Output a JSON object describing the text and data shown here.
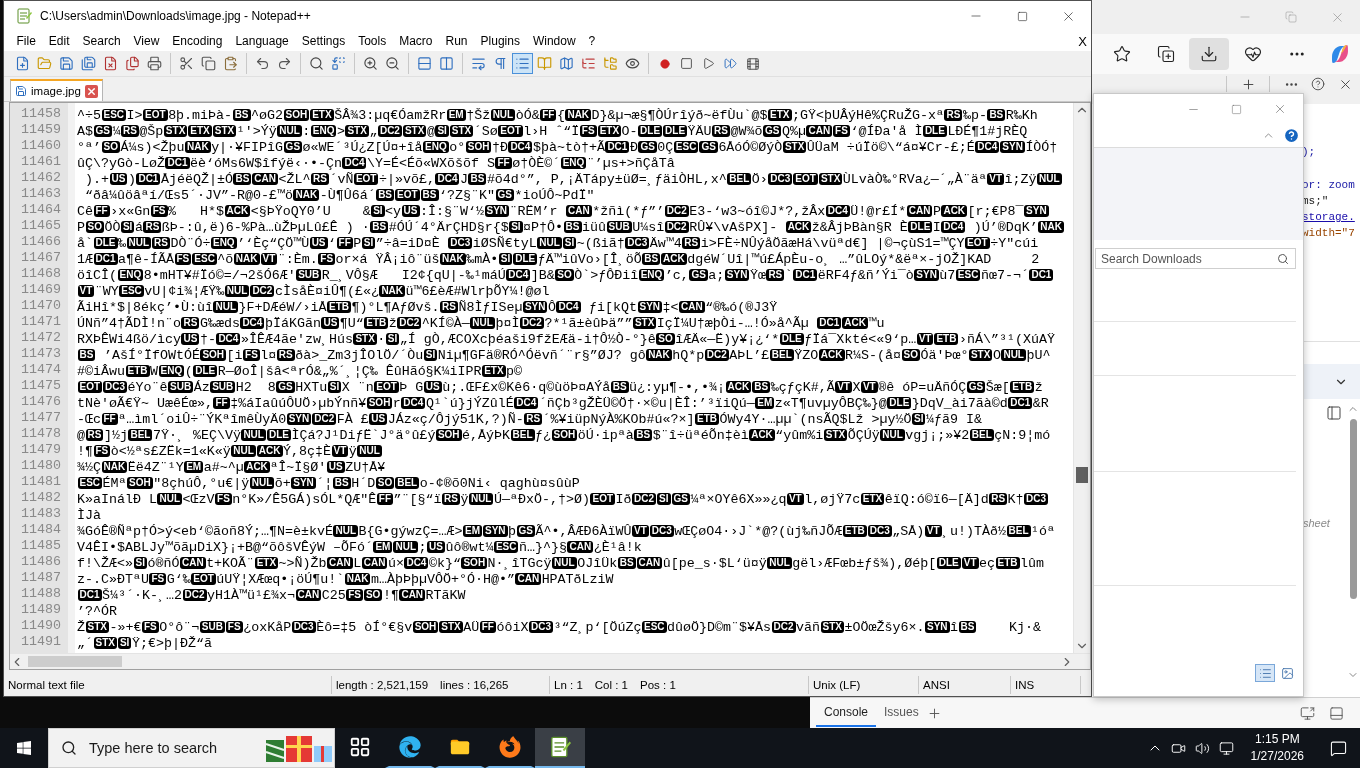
{
  "window": {
    "title": "C:\\Users\\admin\\Downloads\\image.jpg - Notepad++"
  },
  "menu_bar": {
    "items": [
      "File",
      "Edit",
      "Search",
      "View",
      "Encoding",
      "Language",
      "Settings",
      "Tools",
      "Macro",
      "Run",
      "Plugins",
      "Window",
      "?"
    ],
    "close": "X"
  },
  "toolbar": {
    "groups": [
      [
        {
          "kind": "new",
          "on": false
        },
        {
          "kind": "open",
          "on": false
        },
        {
          "kind": "save",
          "on": false
        },
        {
          "kind": "save-all",
          "on": false
        },
        {
          "kind": "close",
          "on": false
        },
        {
          "kind": "close-all",
          "on": false
        },
        {
          "kind": "print",
          "on": false
        }
      ],
      [
        {
          "kind": "cut",
          "on": false
        },
        {
          "kind": "copy",
          "on": false
        },
        {
          "kind": "paste",
          "on": false
        }
      ],
      [
        {
          "kind": "undo",
          "on": false
        },
        {
          "kind": "redo",
          "on": false
        }
      ],
      [
        {
          "kind": "find",
          "on": false
        },
        {
          "kind": "replace",
          "on": false
        }
      ],
      [
        {
          "kind": "zoom-in",
          "on": false
        },
        {
          "kind": "zoom-out",
          "on": false
        }
      ],
      [
        {
          "kind": "sync-v",
          "on": false
        },
        {
          "kind": "sync-h",
          "on": false
        }
      ],
      [
        {
          "kind": "wrap",
          "on": false
        },
        {
          "kind": "all-chars",
          "on": false
        },
        {
          "kind": "indent",
          "on": true
        },
        {
          "kind": "udl",
          "on": false
        },
        {
          "kind": "map",
          "on": false
        },
        {
          "kind": "functions",
          "on": false
        },
        {
          "kind": "workspace",
          "on": false
        },
        {
          "kind": "monitor",
          "on": false
        }
      ],
      [
        {
          "kind": "record",
          "on": false
        },
        {
          "kind": "stop",
          "on": false
        },
        {
          "kind": "play",
          "on": false
        },
        {
          "kind": "play-multi",
          "on": false
        },
        {
          "kind": "save-macro",
          "on": false
        }
      ]
    ]
  },
  "tabs": [
    {
      "label": "image.jpg",
      "selected": true
    }
  ],
  "editor": {
    "lines": [
      {
        "number": "11458",
        "parts": [
          "^÷5",
          {
            "ctrl": "ESC"
          },
          "I>",
          {
            "ctrl": "EOT"
          },
          "8þ.miÞà-",
          {
            "ctrl": "BS"
          },
          "^øG2",
          {
            "ctrl": "SOH"
          },
          {
            "ctrl": "ETX"
          },
          "ŠÂ",
          "¾3:µq€ÓamžRr",
          {
            "ctrl": "EM"
          },
          "†Šž",
          {
            "ctrl": "NUL"
          },
          "òÓ&",
          {
            "ctrl": "FF"
          },
          "{",
          {
            "ctrl": "NAK"
          },
          "D}&µ¬æ§¶ÒÚrîýð~ëfÙu`@$",
          {
            "ctrl": "ETX"
          },
          ";GŸ<þUÂýHê%ÇRuŽG-xª",
          {
            "ctrl": "RS"
          },
          "‰p-",
          {
            "ctrl": "BS"
          },
          "R‰Kh"
        ]
      },
      {
        "number": "11459",
        "parts": [
          "A$",
          {
            "ctrl": "GS"
          },
          "¼",
          {
            "ctrl": "RS"
          },
          "@Šp",
          {
            "ctrl": "STX"
          },
          {
            "ctrl": "ETX"
          },
          {
            "ctrl": "STX"
          },
          "¹'>Ýÿ",
          {
            "ctrl": "NUL"
          },
          ":",
          {
            "ctrl": "ENQ"
          },
          ">",
          {
            "ctrl": "STX"
          },
          "„",
          {
            "ctrl": "DC2"
          },
          {
            "ctrl": "STX"
          },
          "@",
          {
            "ctrl": "SI"
          },
          {
            "ctrl": "STX"
          },
          "´Sø",
          {
            "ctrl": "EOT"
          },
          "l›H ˆ“Ï",
          {
            "ctrl": "FS"
          },
          {
            "ctrl": "ETX"
          },
          "O-",
          {
            "ctrl": "DLE"
          },
          {
            "ctrl": "DLE"
          },
          "ŸÄU",
          {
            "ctrl": "RS"
          },
          "@W¾õ",
          {
            "ctrl": "GS"
          },
          "Q%µ",
          {
            "ctrl": "CAN"
          },
          {
            "ctrl": "FS"
          },
          "‘@ÍÐa'å Ì",
          {
            "ctrl": "DLE"
          },
          "LÐÉ¶1#jRÈQ"
        ]
      },
      {
        "number": "11460",
        "parts": [
          "°ª’",
          {
            "ctrl": "SO"
          },
          "Á¼s)<Žþu",
          {
            "ctrl": "NAK"
          },
          "y|·¥FIPîG",
          {
            "ctrl": "GS"
          },
          "ø«WE´³Ú¿Z[Ú¤+îå",
          {
            "ctrl": "ENQ"
          },
          "o°",
          {
            "ctrl": "SOH"
          },
          "†Ð",
          {
            "ctrl": "DC4"
          },
          "$þà~tò†+Ã",
          {
            "ctrl": "DC1"
          },
          "Ð",
          {
            "ctrl": "GS"
          },
          "0Ç",
          {
            "ctrl": "ESC"
          },
          {
            "ctrl": "GS"
          },
          "6ÅóÓ©ØýÒ",
          {
            "ctrl": "STX"
          },
          "ÛÜaM ÷úÏö©\\“á¤¥Cr-£;É",
          {
            "ctrl": "DC4"
          },
          {
            "ctrl": "SYN"
          },
          "ÍÒÓ†"
        ]
      },
      {
        "number": "11461",
        "parts": [
          "ûÇ\\?yGò-LøŽ",
          {
            "ctrl": "DC1"
          },
          "ëè‘óMs6W$îfýë‹·•-Çn",
          {
            "ctrl": "DC4"
          },
          "\\Y=É<Éõ«WXõšõf S",
          {
            "ctrl": "FF"
          },
          "ø†ÒÈ©´",
          {
            "ctrl": "ENQ"
          },
          "¨’µs+>ñÇåTâ"
        ]
      },
      {
        "number": "11462",
        "parts": [
          " ).+",
          {
            "ctrl": "US"
          },
          ")",
          {
            "ctrl": "DC1"
          },
          "ÅjéëQŽ|±Ó",
          {
            "ctrl": "BS"
          },
          {
            "ctrl": "CAN"
          },
          "<ŽL^",
          {
            "ctrl": "RS"
          },
          "´vÑ",
          {
            "ctrl": "EOT"
          },
          "÷|»võ£,",
          {
            "ctrl": "DC4"
          },
          "J",
          {
            "ctrl": "BS"
          },
          "#õ4d°”, P,¡ÄTápy±üØ=¸ƒäiÒHL,x^",
          {
            "ctrl": "BEL"
          },
          "Ö›",
          {
            "ctrl": "DC3"
          },
          {
            "ctrl": "EOT"
          },
          {
            "ctrl": "STX"
          },
          "ÙLvàÒ‰°RVa¿—´„À¨äª",
          {
            "ctrl": "VT"
          },
          "î;Zÿ",
          {
            "ctrl": "NUL"
          }
        ]
      },
      {
        "number": "11463",
        "parts": [
          " “ðâ",
          "¼ûöâ",
          "ªí/Œs5´·JV”-R@0-£™ö",
          {
            "ctrl": "NAK"
          },
          "-Ù¶Û6á´",
          {
            "ctrl": "BS"
          },
          {
            "ctrl": "EOT"
          },
          {
            "ctrl": "BS"
          },
          "‘?Z§¨K\"",
          {
            "ctrl": "GS"
          },
          "*ioÚÔ~PdÏ\""
        ]
      },
      {
        "number": "11464",
        "parts": [
          "Cê",
          {
            "ctrl": "FF"
          },
          "›x«Gn",
          {
            "ctrl": "FS"
          },
          "%   H*$",
          {
            "ctrl": "ACK"
          },
          "<§ÞŸoQY0’U    &",
          {
            "ctrl": "SI"
          },
          "<y",
          {
            "ctrl": "US"
          },
          ":Î:§¨W‘½",
          {
            "ctrl": "SYN"
          },
          "¨RËM’r ",
          {
            "ctrl": "CAN"
          },
          "*žñì(*ƒ”’",
          {
            "ctrl": "DC2"
          },
          "E3-‘w3~óî©J*?,žÂx",
          {
            "ctrl": "DC4"
          },
          "Ü!@r£Í*",
          {
            "ctrl": "CAN"
          },
          "P",
          {
            "ctrl": "ACK"
          },
          "[r;€P8¯",
          {
            "ctrl": "SYN"
          }
        ]
      },
      {
        "number": "11465",
        "parts": [
          "P",
          {
            "ctrl": "SO"
          },
          "ÖÒ",
          {
            "ctrl": "SI"
          },
          "á",
          {
            "ctrl": "RS"
          },
          "ßÞ-:û,ë)6-%Pà…ùŽÞµLû£Ê ) ·",
          {
            "ctrl": "BS"
          },
          "#ÓÚ´4°ÄrÇHD§r{$",
          {
            "ctrl": "SI"
          },
          "¤P†Ô•",
          {
            "ctrl": "BS"
          },
          "iüû",
          {
            "ctrl": "SUB"
          },
          "U¼sî",
          {
            "ctrl": "DC2"
          },
          "RÛ¥\\vAšPX]- ",
          {
            "ctrl": "ACK"
          },
          "ž&ÂjÞBàn§R È",
          {
            "ctrl": "DLE"
          },
          "I",
          {
            "ctrl": "DC4"
          },
          " )Ú’®DqK’",
          {
            "ctrl": "NAK"
          }
        ]
      },
      {
        "number": "11466",
        "parts": [
          "å`",
          {
            "ctrl": "DLE"
          },
          "‰",
          {
            "ctrl": "NUL"
          },
          {
            "ctrl": "RS"
          },
          "DÒ¨Ó÷",
          {
            "ctrl": "ENQ"
          },
          "’‘Èç“ÇÖ™Ù",
          {
            "ctrl": "US"
          },
          "‘",
          {
            "ctrl": "FF"
          },
          "P",
          {
            "ctrl": "SI"
          },
          "”÷â=iD¤È ",
          {
            "ctrl": "DC3"
          },
          "iØSÑ€tyL",
          {
            "ctrl": "NUL"
          },
          {
            "ctrl": "SI"
          },
          "~(ßiã†",
          {
            "ctrl": "DC3"
          },
          "Äw™4",
          {
            "ctrl": "RS"
          },
          "i>FÈ÷NÛýåÖãæHá\\vüªd€] |©¬çùS1=™ÇY",
          {
            "ctrl": "EOT"
          },
          "÷Y\"cúi"
        ]
      },
      {
        "number": "11467",
        "parts": [
          "1Æ",
          {
            "ctrl": "DC1"
          },
          "a¶ê-ÍÃÅ",
          {
            "ctrl": "FS"
          },
          {
            "ctrl": "ESC"
          },
          "^õ",
          {
            "ctrl": "NAK"
          },
          {
            "ctrl": "VT"
          },
          "¨:Èm.",
          {
            "ctrl": "FS"
          },
          "or×á ŸÂ",
          "¡iô¨üš",
          {
            "ctrl": "NAK"
          },
          "‰mÀ•",
          {
            "ctrl": "SI"
          },
          {
            "ctrl": "DLE"
          },
          "ƒÄ™iûVo›[Î¸öÕ",
          {
            "ctrl": "BS"
          },
          {
            "ctrl": "ACK"
          },
          "dgéW´Uî|™ú£ÁpÈu-o¸ …”ûLOý*&ëª×-jOŽ]KAD     2"
        ]
      },
      {
        "number": "11468",
        "parts": [
          "öîCÎ(",
          {
            "ctrl": "ENQ"
          },
          "8•mHT¥#Ïó©=/¬2šÓ6Æ'",
          {
            "ctrl": "SUB"
          },
          "R_¸VÔ§Æ   I2¢{qU|-‰¹máÚ",
          {
            "ctrl": "DC4"
          },
          "]B&",
          {
            "ctrl": "SO"
          },
          "Ò`>ƒÔÐiî",
          {
            "ctrl": "ENQ"
          },
          "’c,",
          {
            "ctrl": "GS"
          },
          "a;",
          {
            "ctrl": "SYN"
          },
          "Ÿœ",
          {
            "ctrl": "RS"
          },
          "`",
          {
            "ctrl": "DC1"
          },
          "ëRF4ƒ&ñ’Ýi¯ò",
          {
            "ctrl": "SYN"
          },
          "ù7",
          {
            "ctrl": "ESC"
          },
          "ñœ7-¬´",
          {
            "ctrl": "DC1"
          }
        ]
      },
      {
        "number": "11469",
        "parts": [
          {
            "ctrl": "VT"
          },
          "¨WY",
          {
            "ctrl": "ESC"
          },
          "vU|¢i¾¦ÆŸ‰",
          {
            "ctrl": "NUL"
          },
          {
            "ctrl": "DC2"
          },
          "cÌsåÈ¤iÛ¶(£«¿",
          {
            "ctrl": "NAK"
          },
          "ü™6£èÆ#WlrþÕY¼!@øl"
        ]
      },
      {
        "number": "11470",
        "parts": [
          "ÃiHî*$|8ékç’•Ù:ùî",
          {
            "ctrl": "NUL"
          },
          "}F+DÆéW/›iÅ",
          {
            "ctrl": "ETB"
          },
          "¶)°L¶AƒØvš.",
          {
            "ctrl": "RS"
          },
          "Ñ8ÌƒISeµ",
          {
            "ctrl": "SYN"
          },
          "Ô",
          {
            "ctrl": "DC4"
          },
          " ƒi[kQt",
          {
            "ctrl": "SYN"
          },
          "‡<",
          {
            "ctrl": "CAN"
          },
          "“®‰ó(®J3Ÿ"
        ]
      },
      {
        "number": "11471",
        "parts": [
          "ÚNñ”4†ÃDÌ!n¨o",
          {
            "ctrl": "RS"
          },
          "G‰æds",
          {
            "ctrl": "DC4"
          },
          "þÏáKGãn",
          {
            "ctrl": "US"
          },
          "¶U“",
          {
            "ctrl": "ETB"
          },
          "ž",
          {
            "ctrl": "DC2"
          },
          "^KÍ©À—",
          {
            "ctrl": "NUL"
          },
          "þ¤Ì",
          {
            "ctrl": "DC2"
          },
          "?*¹ã±èûÞä””",
          {
            "ctrl": "STX"
          },
          "IçÏ¼U†æþÒi-…!Ó»å^Ã",
          "µ ",
          {
            "ctrl": "DC1"
          },
          {
            "ctrl": "ACK"
          },
          "™u"
        ]
      },
      {
        "number": "11472",
        "parts": [
          "RXÞÊWi4ßö/ìcy",
          {
            "ctrl": "US"
          },
          "†-",
          {
            "ctrl": "DC4"
          },
          "»ÎÊÆ4ãe'zw¸Hús",
          {
            "ctrl": "STX"
          },
          "·",
          {
            "ctrl": "SI"
          },
          "„Í gÒ,ÆCOXcþéaši9fžEÆä-i†Ô½Ò-°}ê",
          {
            "ctrl": "SO"
          },
          "îÆÄ«—Ë)y¥¡¿‘*",
          {
            "ctrl": "DLE"
          },
          "ƒÏá¯Xkté<«9‘p…",
          {
            "ctrl": "VT"
          },
          {
            "ctrl": "ETB"
          },
          "›ñÁ\\”³¹(XúAŸ"
        ]
      },
      {
        "number": "11473",
        "parts": [
          {
            "ctrl": "BS"
          },
          " ’AšÍ°ÏfOWtÓÉ",
          {
            "ctrl": "SOH"
          },
          "[i",
          {
            "ctrl": "FS"
          },
          "l¤",
          {
            "ctrl": "RS"
          },
          "ðà>_Zm3jÎOlÖ/´Òu",
          {
            "ctrl": "SI"
          },
          "Niµ¶GFä®RÓ^Óëvñ´¨r§”ØJ? gô",
          {
            "ctrl": "NAK"
          },
          "hQ*p",
          {
            "ctrl": "DC2"
          },
          "AÞL’£",
          {
            "ctrl": "BEL"
          },
          "ŸZO",
          {
            "ctrl": "ACK"
          },
          "R¼S-(å¤",
          {
            "ctrl": "SO"
          },
          "Óä'Þœ°",
          {
            "ctrl": "STX"
          },
          "O",
          {
            "ctrl": "NUL"
          },
          "þU^"
        ]
      },
      {
        "number": "11474",
        "parts": [
          "#©iÂwu",
          {
            "ctrl": "ETB"
          },
          "W",
          {
            "ctrl": "ENQ"
          },
          "(",
          {
            "ctrl": "DLE"
          },
          "R—ØoÎ|šâ<ªrÓ&„%´¸¦Ç‰ ÊûHãó§K¼iIPR",
          {
            "ctrl": "ETX"
          },
          "p©"
        ]
      },
      {
        "number": "11475",
        "parts": [
          {
            "ctrl": "EOT"
          },
          {
            "ctrl": "DC3"
          },
          "éYo¨ê",
          {
            "ctrl": "SUB"
          },
          "Áz",
          {
            "ctrl": "SUB"
          },
          "H2  8",
          {
            "ctrl": "GS"
          },
          "HXTu",
          {
            "ctrl": "SI"
          },
          "X ¨n",
          {
            "ctrl": "EOT"
          },
          "Þ G",
          {
            "ctrl": "US"
          },
          "ù;.ŒF£x©Kê6·q©ùöÞ¤AÝå",
          {
            "ctrl": "BS"
          },
          "ü¿:yµ¶-•,•¾¡",
          {
            "ctrl": "ACK"
          },
          {
            "ctrl": "BS"
          },
          "‰çƒçK#,Ã",
          {
            "ctrl": "VT"
          },
          "X",
          {
            "ctrl": "VT"
          },
          "®ê óP=uÄñÓÇ",
          {
            "ctrl": "GS"
          },
          "Šæ[",
          {
            "ctrl": "ETB"
          },
          "ž"
        ]
      },
      {
        "number": "11476",
        "parts": [
          "tNè'øÃ",
          "€Ÿ~ UæêÉœ»,",
          {
            "ctrl": "FF"
          },
          "‡%áIaûúÔUÖ›µbÝnñ¥",
          {
            "ctrl": "SOH"
          },
          "r",
          {
            "ctrl": "DC4"
          },
          "Q¹`ú}jÝZûlÉ",
          {
            "ctrl": "DC4"
          },
          "´ñÇb³gŽÈÜ©Ö†·×©u|ÈÎ:’³ïiQú—",
          {
            "ctrl": "EM"
          },
          "z«T¶uvµyÔBÇ‰}@",
          {
            "ctrl": "DLE"
          },
          "}DqV_ài7ãà©d",
          {
            "ctrl": "DC1"
          },
          "&R"
        ]
      },
      {
        "number": "11477",
        "parts": [
          "-Œc",
          {
            "ctrl": "FF"
          },
          "ª…ìml´oiÛ÷¨ÝKªîmêÙyÄ0",
          {
            "ctrl": "SYN"
          },
          {
            "ctrl": "DC2"
          },
          "FÀ £",
          {
            "ctrl": "US"
          },
          "JÁz«ç/Ôjý51K,?)Ñ-",
          {
            "ctrl": "RS"
          },
          "´%¥iüpNýÀ%KOb#ú«?×]",
          {
            "ctrl": "ETB"
          },
          "ÓWy4Y·…µµ`(nsÃQ$Lž >µy½Ö",
          {
            "ctrl": "SI"
          },
          "¼ƒã9 I&"
        ]
      },
      {
        "number": "11478",
        "parts": [
          "@",
          {
            "ctrl": "RS"
          },
          "]½j",
          {
            "ctrl": "BEL"
          },
          "7Ÿ·¸ %EÇ\\Vÿ",
          {
            "ctrl": "NUL"
          },
          {
            "ctrl": "DLE"
          },
          "ÌÇá?J¹DiƒË`J°ä°û£ý",
          {
            "ctrl": "SOH"
          },
          "é,ÅýÞK",
          {
            "ctrl": "BEL"
          },
          "ƒ¿",
          {
            "ctrl": "SOH"
          },
          "öÚ·ipªà",
          {
            "ctrl": "BS"
          },
          "$¨î÷üªéÕn‡èì",
          {
            "ctrl": "ACK"
          },
          "“yûm%i",
          {
            "ctrl": "STX"
          },
          "ÕÇÚÿ",
          {
            "ctrl": "NUL"
          },
          "vgj¡;»¥2",
          {
            "ctrl": "BEL"
          },
          "çN:9¦mó"
        ]
      },
      {
        "number": "11479",
        "parts": [
          "!¶",
          {
            "ctrl": "FS"
          },
          "ò<½ªs£ZËk=1«K«ÿ",
          {
            "ctrl": "NUL"
          },
          {
            "ctrl": "ACK"
          },
          "Ý,8ç‡È",
          {
            "ctrl": "VT"
          },
          "ÿ",
          {
            "ctrl": "NUL"
          }
        ]
      },
      {
        "number": "11480",
        "parts": [
          "¾½Ç",
          {
            "ctrl": "NAK"
          },
          "Ëë4Z¨¹Y",
          {
            "ctrl": "EM"
          },
          "a#~^µ",
          {
            "ctrl": "ACK"
          },
          "ªÎ~Ï§Ø'",
          {
            "ctrl": "US"
          },
          "ZU†Å¥"
        ]
      },
      {
        "number": "11481",
        "parts": [
          {
            "ctrl": "ESC"
          },
          "ÉMª",
          {
            "ctrl": "SOH"
          },
          "\"8çhúÔ,°u€|ÿ",
          {
            "ctrl": "NUL"
          },
          "õ+",
          {
            "ctrl": "SYN"
          },
          "´¦",
          {
            "ctrl": "BS"
          },
          "H´D",
          {
            "ctrl": "SO"
          },
          {
            "ctrl": "BEL"
          },
          "o-¢®õ0Ni‹ qaghù¤sûùP"
        ]
      },
      {
        "number": "11482",
        "parts": [
          "K»aInálÐ L",
          {
            "ctrl": "NUL"
          },
          "<ŒzV",
          {
            "ctrl": "FS"
          },
          "n°K»/Ê5GÁ)sÓL*QÆ\"Ê",
          {
            "ctrl": "FF"
          },
          "”¨[§“ï",
          {
            "ctrl": "RS"
          },
          "ÿ",
          {
            "ctrl": "NUL"
          },
          "Ú—ªÐxÖ-,†>Ø)",
          {
            "ctrl": "EOT"
          },
          "Ið",
          {
            "ctrl": "DC2"
          },
          {
            "ctrl": "SI"
          },
          {
            "ctrl": "GS"
          },
          "¼ª×OYê6X»»¿q",
          {
            "ctrl": "VT"
          },
          "l,øjŸ7c",
          {
            "ctrl": "ETX"
          },
          "êïQ:ó©ï6—[Ä]d",
          {
            "ctrl": "RS"
          },
          "K†",
          {
            "ctrl": "DC3"
          }
        ]
      },
      {
        "number": "11483",
        "parts": [
          "ÌJà"
        ]
      },
      {
        "number": "11484",
        "parts": [
          "¾GóÊ®Ñªp†Ó>ý<eb‘©ãoñ8Ý;…¶N=è±kvÉ",
          {
            "ctrl": "NUL"
          },
          "B{G•gýwzÇ=…Æ>",
          {
            "ctrl": "EM"
          },
          {
            "ctrl": "SYN"
          },
          "þ",
          {
            "ctrl": "GS"
          },
          "Ã^•,ÂÆÐ6ÀïWÛ",
          {
            "ctrl": "VT"
          },
          {
            "ctrl": "DC3"
          },
          "wŒÇøO4·›J`*@?(ùj‰ñJÕÆ",
          {
            "ctrl": "ETB"
          },
          {
            "ctrl": "DC3"
          },
          "„SÅ)",
          {
            "ctrl": "VT"
          },
          "¸u!)TÀð½",
          {
            "ctrl": "BEL"
          },
          "¹óª"
        ]
      },
      {
        "number": "11485",
        "parts": [
          "V4ÊI•$ABLJy™õãµDiX}¡+B@“õôšVÊýW –ÕFó´",
          {
            "ctrl": "EM"
          },
          {
            "ctrl": "NUL"
          },
          ";",
          {
            "ctrl": "US"
          },
          "ûô®wt¼",
          {
            "ctrl": "ESC"
          },
          "ñ…}^}§",
          {
            "ctrl": "CAN"
          },
          "¿È¹â!k"
        ]
      },
      {
        "number": "11486",
        "parts": [
          "f!\\ŽÆ<»",
          {
            "ctrl": "SI"
          },
          "ó®ñÓ",
          {
            "ctrl": "CAN"
          },
          "t+KOÃ",
          "¨",
          {
            "ctrl": "ETX"
          },
          "~>Ñ)Žb",
          {
            "ctrl": "CAN"
          },
          "L",
          {
            "ctrl": "CAN"
          },
          "ú×",
          {
            "ctrl": "DC4"
          },
          "©k}“",
          {
            "ctrl": "SOH"
          },
          "N·¸îTGcÿ",
          {
            "ctrl": "NUL"
          },
          "OJîÜk",
          {
            "ctrl": "BS"
          },
          {
            "ctrl": "CAN"
          },
          "û[pe_s·$L‘ü¤ÿ",
          {
            "ctrl": "NUL"
          },
          "gël›ÆFœb±ƒš¾),Øéþ[",
          {
            "ctrl": "DLE"
          },
          {
            "ctrl": "VT"
          },
          "eç",
          {
            "ctrl": "ETB"
          },
          "lûm"
        ]
      },
      {
        "number": "11487",
        "parts": [
          "z-.C»ÐTªU",
          {
            "ctrl": "FS"
          },
          "G‘‰",
          {
            "ctrl": "EOT"
          },
          "úUŸ¦XÆœq•¡öÚ¶u!`",
          {
            "ctrl": "NAK"
          },
          "m…ÀþÞþµVÔÖ+°Ó·H@•”",
          {
            "ctrl": "CAN"
          },
          "HPATðLziW"
        ]
      },
      {
        "number": "11488",
        "parts": [
          {
            "ctrl": "DC1"
          },
          "Š¼³´·K-¸…2",
          {
            "ctrl": "DC2"
          },
          "yH1À™ü¹£¾x¬",
          {
            "ctrl": "CAN"
          },
          "C25",
          {
            "ctrl": "FS"
          },
          {
            "ctrl": "SO"
          },
          "!¶",
          {
            "ctrl": "CAN"
          },
          "RTãKW"
        ]
      },
      {
        "number": "11489",
        "parts": [
          "’?^ÓR"
        ]
      },
      {
        "number": "11490",
        "parts": [
          "Ž",
          {
            "ctrl": "STX"
          },
          "-»+€",
          {
            "ctrl": "FS"
          },
          "O°ô¨¬",
          {
            "ctrl": "SUB"
          },
          {
            "ctrl": "FS"
          },
          "¿oxKåP",
          {
            "ctrl": "DC3"
          },
          "Èô=‡5 òÍ°€§v",
          {
            "ctrl": "SOH"
          },
          {
            "ctrl": "STX"
          },
          "AÜ",
          {
            "ctrl": "FF"
          },
          "óôiX",
          {
            "ctrl": "DC3"
          },
          "³“Z¸p‘[ÖúZç",
          {
            "ctrl": "ESC"
          },
          "dûøÖ}D©m¨$¥Ås",
          {
            "ctrl": "DC2"
          },
          "vãñ",
          {
            "ctrl": "STX"
          },
          "±OÖœŽšy6×.",
          {
            "ctrl": "SYN"
          },
          "î",
          {
            "ctrl": "BS"
          },
          "    Kj·&"
        ]
      },
      {
        "number": "11491",
        "parts": [
          "„´",
          {
            "ctrl": "STX"
          },
          {
            "ctrl": "SI"
          },
          "Ÿ;€>þ|ÐŽ“ã"
        ]
      }
    ]
  },
  "status_bar": {
    "file_type": "Normal text file",
    "length": "length : 2,521,159",
    "lines": "lines : 16,265",
    "line": "Ln : 1",
    "column": "Col : 1",
    "position": "Pos : 1",
    "eol": "Unix (LF)",
    "encoding": "ANSI",
    "mode": "INS"
  },
  "browser": {
    "downloads": {
      "search": {
        "placeholder": "Search Downloads"
      },
      "view_toggles": [
        {
          "kind": "list",
          "selected": true
        },
        {
          "kind": "thumbnails",
          "selected": false
        }
      ]
    },
    "code_lines": [
      ");",
      "or: zoom",
      "ms;\"",
      "storage.",
      "width=\"7"
    ],
    "sheet_label": "sheet",
    "drawer_tabs": [
      {
        "label": "Console",
        "selected": true
      },
      {
        "label": "Issues",
        "selected": false
      }
    ]
  },
  "taskbar": {
    "search": {
      "placeholder": "Type here to search"
    },
    "apps": [
      {
        "kind": "task-view",
        "running": false,
        "selected": false
      },
      {
        "kind": "edge",
        "running": true,
        "selected": false
      },
      {
        "kind": "explorer",
        "running": true,
        "selected": false
      },
      {
        "kind": "firefox",
        "running": true,
        "selected": false
      },
      {
        "kind": "notepad",
        "running": true,
        "selected": true
      }
    ],
    "clock": {
      "time": "1:15 PM",
      "date": "1/27/2026"
    }
  }
}
